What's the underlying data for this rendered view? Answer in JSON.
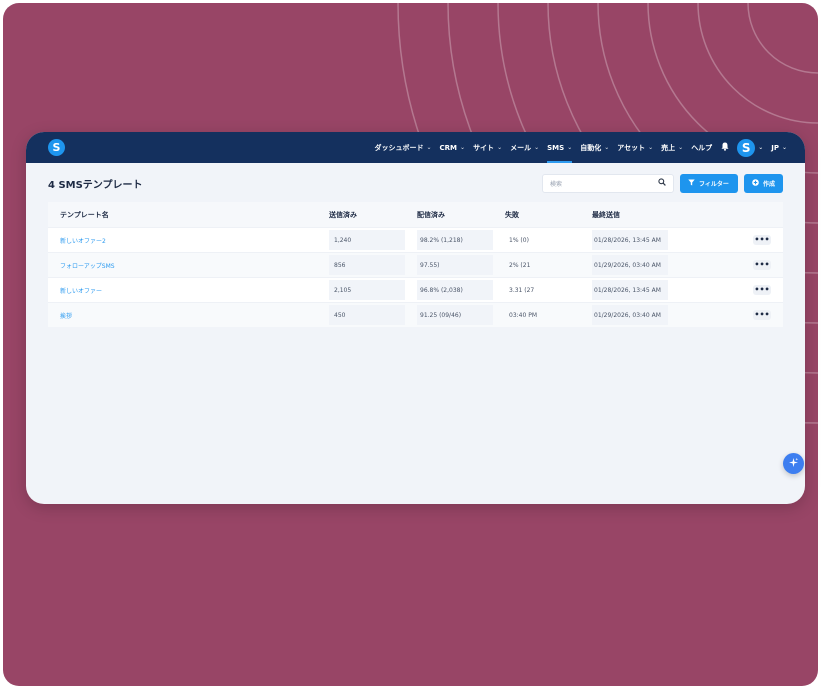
{
  "nav": {
    "items": [
      {
        "label": "ダッシュボード",
        "chevron": "⌄"
      },
      {
        "label": "CRM",
        "chevron": "⌄"
      },
      {
        "label": "サイト",
        "chevron": "⌄"
      },
      {
        "label": "メール",
        "chevron": "⌄"
      },
      {
        "label": "SMS",
        "chevron": "⌄"
      },
      {
        "label": "自動化",
        "chevron": "⌄"
      },
      {
        "label": "アセット",
        "chevron": "⌄"
      },
      {
        "label": "売上",
        "chevron": "⌄"
      },
      {
        "label": "ヘルプ"
      }
    ],
    "logo_letter": "S",
    "avatar_letter": "S",
    "lang": "JP"
  },
  "page": {
    "title": "4 SMSテンプレート",
    "search_placeholder": "検索",
    "filter_label": "フィルター",
    "create_label": "作成"
  },
  "table": {
    "headers": [
      "テンプレート名",
      "送信済み",
      "配信済み",
      "失敗",
      "最終送信"
    ],
    "rows": [
      {
        "name": "新しいオファー2",
        "sent": "1,240",
        "delivered": "98.2% (1,218)",
        "failed": "1% (0)",
        "last": "01/28/2026, 13:45 AM"
      },
      {
        "name": "フォローアップSMS",
        "sent": "856",
        "delivered": "97.55)",
        "failed": "2% (21",
        "last": "01/29/2026, 03:40 AM"
      },
      {
        "name": "新しいオファー",
        "sent": "2,105",
        "delivered": "96.8% (2,038)",
        "failed": "3.31 (27",
        "last": "01/28/2026, 13:45 AM"
      },
      {
        "name": "挨拶",
        "sent": "450",
        "delivered": "91.25 (09/46)",
        "failed": "03:40 PM",
        "last": "01/29/2026, 03:40 AM"
      }
    ],
    "more_glyph": "•••"
  },
  "colors": {
    "backdrop": "#984566",
    "navbar": "#14305e",
    "accent": "#1e95ee",
    "canvas": "#f1f4f9"
  },
  "icons": {
    "search": "search-icon",
    "filter": "filter-icon",
    "create": "plus-circle-icon",
    "bell": "bell-icon",
    "fab": "sparkle-icon"
  }
}
